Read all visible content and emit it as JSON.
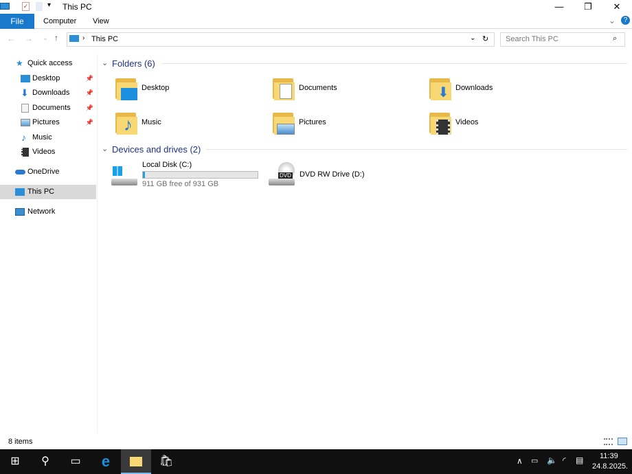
{
  "window": {
    "title": "This PC"
  },
  "ribbon": {
    "file": "File",
    "tabs": [
      "Computer",
      "View"
    ]
  },
  "nav": {
    "location": "This PC",
    "search_placeholder": "Search This PC"
  },
  "sidebar": {
    "quick_access": "Quick access",
    "items": [
      {
        "label": "Desktop",
        "pinned": true
      },
      {
        "label": "Downloads",
        "pinned": true
      },
      {
        "label": "Documents",
        "pinned": true
      },
      {
        "label": "Pictures",
        "pinned": true
      },
      {
        "label": "Music",
        "pinned": false
      },
      {
        "label": "Videos",
        "pinned": false
      }
    ],
    "onedrive": "OneDrive",
    "this_pc": "This PC",
    "network": "Network"
  },
  "folders": {
    "header": "Folders (6)",
    "items": [
      "Desktop",
      "Documents",
      "Downloads",
      "Music",
      "Pictures",
      "Videos"
    ]
  },
  "drives": {
    "header": "Devices and drives (2)",
    "local": {
      "name": "Local Disk (C:)",
      "free": "911 GB free of 931 GB",
      "used_percent": 2
    },
    "dvd": {
      "name": "DVD RW Drive (D:)",
      "badge": "DVD"
    }
  },
  "status": {
    "items": "8 items"
  },
  "taskbar": {
    "time": "11:39",
    "date": "24.8.2025."
  },
  "colors": {
    "accent": "#1979ca",
    "taskbar": "#101010"
  }
}
